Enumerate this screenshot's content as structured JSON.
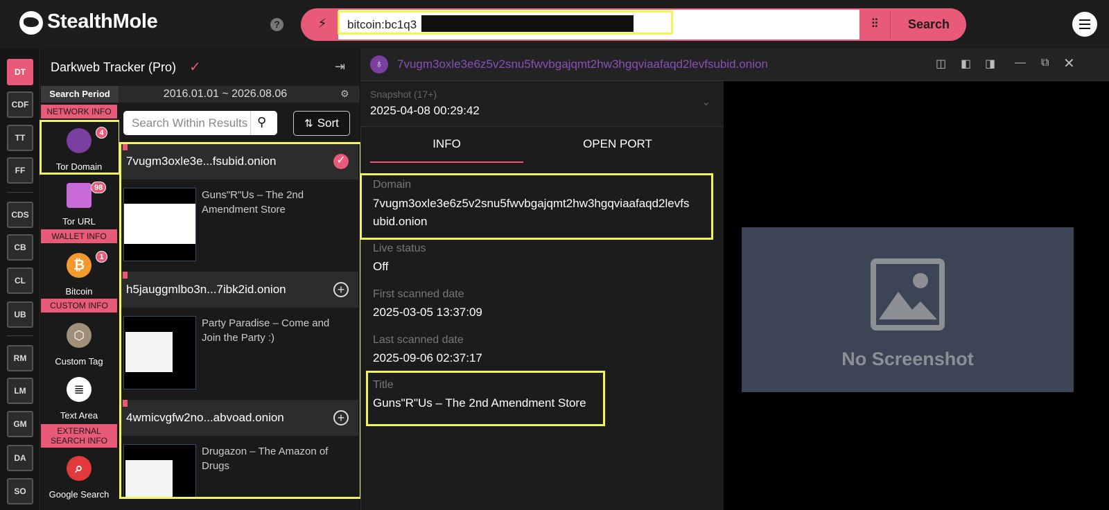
{
  "header": {
    "logo": "StealthMole",
    "help": "?",
    "search": {
      "value": "bitcoin:bc1q3                                             h8nv",
      "button": "Search"
    }
  },
  "rail": [
    "DT",
    "CDF",
    "TT",
    "FF",
    "CDS",
    "CB",
    "CL",
    "UB",
    "RM",
    "LM",
    "GM",
    "DA",
    "SO"
  ],
  "panel": {
    "title": "Darkweb Tracker (Pro)",
    "period_label": "Search Period",
    "period_range": "2016.01.01 ~ 2026.08.06"
  },
  "categories": {
    "network_info": "NETWORK INFO",
    "tor_domain": {
      "label": "Tor Domain",
      "count": "4"
    },
    "tor_url": {
      "label": "Tor URL",
      "count": "98"
    },
    "wallet_info": "WALLET INFO",
    "bitcoin": {
      "label": "Bitcoin",
      "count": "1"
    },
    "custom_info": "CUSTOM INFO",
    "custom_tag": {
      "label": "Custom Tag"
    },
    "text_area": {
      "label": "Text Area"
    },
    "external_line1": "EXTERNAL",
    "external_line2": "SEARCH INFO",
    "google_search": {
      "label": "Google Search"
    }
  },
  "results": {
    "search_placeholder": "Search Within Results",
    "sort_label": "Sort",
    "items": [
      {
        "name": "7vugm3oxle3e...fsubid.onion",
        "title": "Guns\"R\"Us – The 2nd Amendment Store",
        "selected": true
      },
      {
        "name": "h5jauggmlbo3n...7ibk2id.onion",
        "title": "Party Paradise – Come and Join the Party :)",
        "selected": false
      },
      {
        "name": "4wmicvgfw2no...abvoad.onion",
        "title": "Drugazon – The Amazon of Drugs",
        "selected": false
      }
    ]
  },
  "detail": {
    "domain_title": "7vugm3oxle3e6z5v2snu5fwvbgajqmt2hw3hgqviaafaqd2levfsubid.onion",
    "snapshot_label": "Snapshot (17+)",
    "snapshot_value": "2025-04-08 00:29:42",
    "tabs": [
      "INFO",
      "OPEN PORT"
    ],
    "fields": {
      "domain_label": "Domain",
      "domain_line1": "7vugm3oxle3e6z5v2snu5fwvbgajqmt2hw3hgqviaafaqd2levfs",
      "domain_line2": "ubid.onion",
      "live_label": "Live status",
      "live_value": "Off",
      "first_label": "First scanned date",
      "first_value": "2025-03-05 13:37:09",
      "last_label": "Last scanned date",
      "last_value": "2025-09-06 02:37:17",
      "title_label": "Title",
      "title_value": "Guns\"R\"Us – The 2nd Amendment Store"
    },
    "no_screenshot": "No Screenshot"
  },
  "colors": {
    "accent": "#e95a78",
    "highlight": "#f2f55a",
    "tor_purple": "#8a4fb8"
  }
}
